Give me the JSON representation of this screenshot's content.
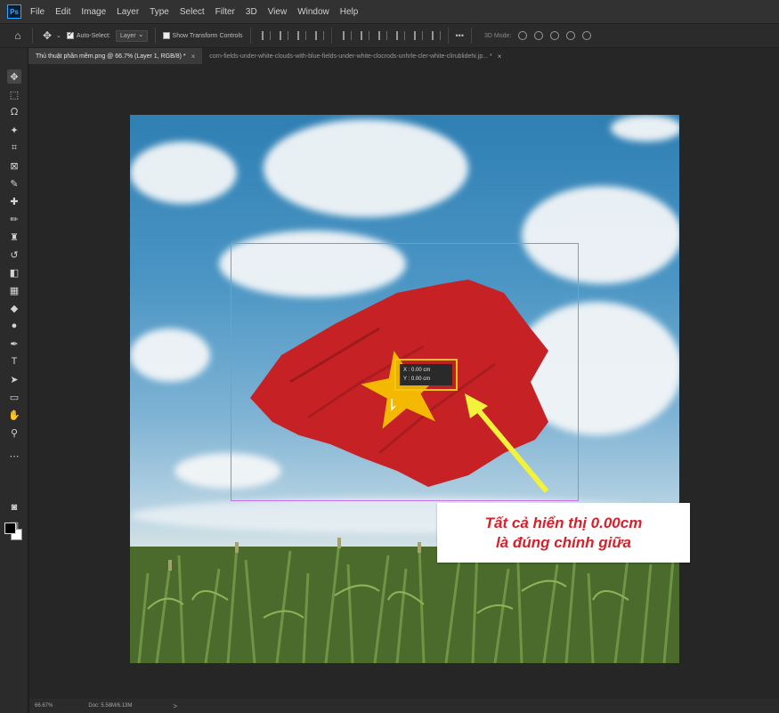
{
  "app": {
    "logo": "Ps"
  },
  "menu": [
    "File",
    "Edit",
    "Image",
    "Layer",
    "Type",
    "Select",
    "Filter",
    "3D",
    "View",
    "Window",
    "Help"
  ],
  "options_bar": {
    "home_icon": "home-icon",
    "move_icon": "move-icon",
    "auto_select_label": "Auto-Select:",
    "auto_select_checked": true,
    "auto_select_value": "Layer",
    "show_transform_label": "Show Transform Controls",
    "show_transform_checked": false,
    "more_label": "•••",
    "mode_3d_label": "3D Mode:"
  },
  "tabs": [
    {
      "label": "Thủ thuật phần mềm.png @ 66.7% (Layer 1, RGB/8) *",
      "active": true
    },
    {
      "label": "corn-fields-under-white-clouds-with-blue-fields-under-white-clocrods-unhrle-cler-white-clirublidehi.jp... *",
      "active": false
    }
  ],
  "tools": [
    "move-icon",
    "marquee-icon",
    "lasso-icon",
    "magic-wand-icon",
    "crop-icon",
    "frame-icon",
    "eyedropper-icon",
    "healing-icon",
    "brush-icon",
    "stamp-icon",
    "history-brush-icon",
    "eraser-icon",
    "gradient-icon",
    "blur-icon",
    "dodge-icon",
    "pen-icon",
    "type-icon",
    "path-select-icon",
    "rectangle-icon",
    "hand-icon",
    "zoom-icon",
    "more-tools-icon"
  ],
  "readout": {
    "x_label": "X :",
    "x_value": "0.00 cm",
    "y_label": "Y :",
    "y_value": "0.00 cm"
  },
  "callout": {
    "line1": "Tất cả hiển thị 0.00cm",
    "line2": "là đúng chính giữa"
  },
  "status": {
    "zoom": "66.67%",
    "doc": "Doc: 5.58M/6.13M",
    "chevron": ">"
  },
  "colors": {
    "flag_red": "#c62226",
    "star_yellow": "#f5b800",
    "guide_purple": "#c86fe8",
    "arrow_yellow": "#f2f23a",
    "callout_text": "#d7202a"
  }
}
